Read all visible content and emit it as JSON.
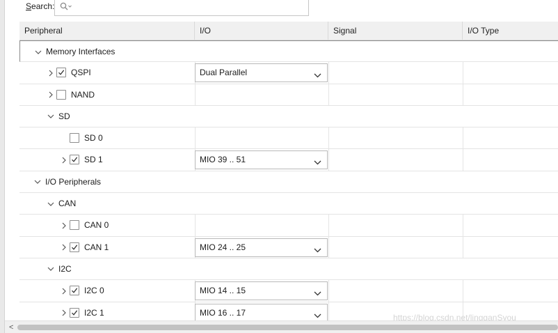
{
  "search": {
    "label_prefix": "S",
    "label_rest": "earch:"
  },
  "columns": [
    "Peripheral",
    "I/O",
    "Signal",
    "I/O Type"
  ],
  "rows": [
    {
      "kind": "group",
      "label": "Memory Interfaces"
    },
    {
      "kind": "item",
      "label": "QSPI",
      "checked": true,
      "io": "Dual Parallel"
    },
    {
      "kind": "item",
      "label": "NAND",
      "checked": false,
      "io": ""
    },
    {
      "kind": "group",
      "label": "SD"
    },
    {
      "kind": "item",
      "label": "SD 0",
      "checked": false,
      "io": ""
    },
    {
      "kind": "item",
      "label": "SD 1",
      "checked": true,
      "io": "MIO 39 .. 51"
    },
    {
      "kind": "group",
      "label": "I/O Peripherals"
    },
    {
      "kind": "group",
      "label": "CAN"
    },
    {
      "kind": "item",
      "label": "CAN 0",
      "checked": false,
      "io": ""
    },
    {
      "kind": "item",
      "label": "CAN 1",
      "checked": true,
      "io": "MIO 24 .. 25"
    },
    {
      "kind": "group",
      "label": "I2C"
    },
    {
      "kind": "item",
      "label": "I2C 0",
      "checked": true,
      "io": "MIO 14 .. 15"
    },
    {
      "kind": "item",
      "label": "I2C 1",
      "checked": true,
      "io": "MIO 16 .. 17"
    }
  ],
  "watermark": "https://blog.csdn.net/lingganSyou"
}
